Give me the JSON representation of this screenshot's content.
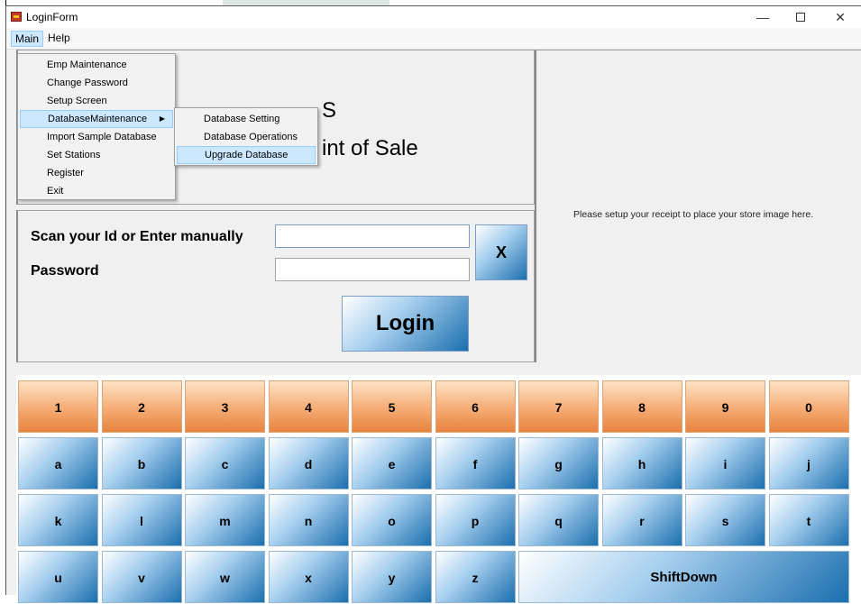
{
  "window": {
    "title": "LoginForm",
    "minimize": "—",
    "close": "✕"
  },
  "menubar": {
    "main": "Main",
    "help": "Help"
  },
  "main_menu": {
    "items": [
      {
        "label": "Emp Maintenance"
      },
      {
        "label": "Change Password"
      },
      {
        "label": "Setup Screen"
      },
      {
        "label": "DatabaseMaintenance",
        "has_submenu": true,
        "highlighted": true
      },
      {
        "label": "Import Sample Database"
      },
      {
        "label": "Set Stations"
      },
      {
        "label": "Register"
      },
      {
        "label": "Exit"
      }
    ],
    "submenu_arrow": "▶"
  },
  "submenu": {
    "items": [
      {
        "label": "Database Setting"
      },
      {
        "label": "Database Operations"
      },
      {
        "label": "Upgrade Database",
        "highlighted": true
      }
    ]
  },
  "header": {
    "line1": "S",
    "line2": "int of Sale"
  },
  "store_image": {
    "message": "Please setup your receipt to place your store image here."
  },
  "login": {
    "scan_label": "Scan your Id or Enter manually",
    "password_label": "Password",
    "scan_value": "",
    "password_value": "",
    "clear_label": "X",
    "login_label": "Login"
  },
  "keypad": {
    "rows": [
      [
        "1",
        "2",
        "3",
        "4",
        "5",
        "6",
        "7",
        "8",
        "9",
        "0"
      ],
      [
        "a",
        "b",
        "c",
        "d",
        "e",
        "f",
        "g",
        "h",
        "i",
        "j"
      ],
      [
        "k",
        "l",
        "m",
        "n",
        "o",
        "p",
        "q",
        "r",
        "s",
        "t"
      ],
      [
        "u",
        "v",
        "w",
        "x",
        "y",
        "z"
      ]
    ],
    "shift_label": "ShiftDown"
  },
  "colors": {
    "accent_blue": "#1b6fae",
    "accent_orange": "#e8833d",
    "menu_highlight": "#cce8ff"
  }
}
